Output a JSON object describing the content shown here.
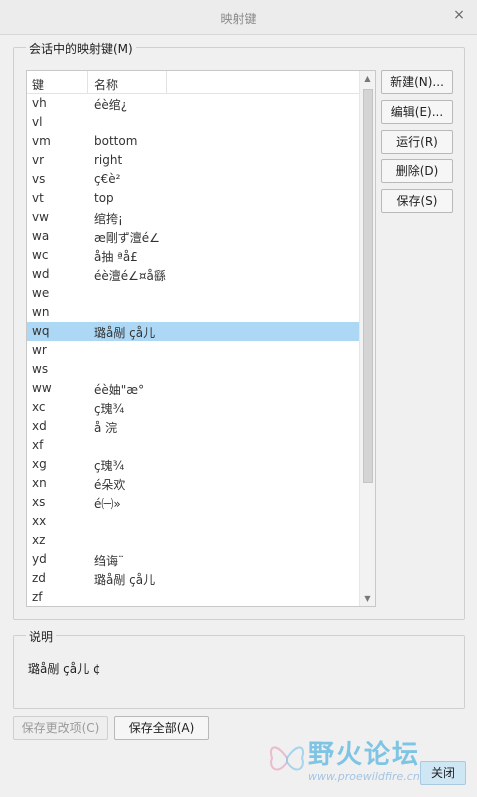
{
  "window": {
    "title": "映射键",
    "close_symbol": "×"
  },
  "mappings_group": {
    "label": "会话中的映射键(M)"
  },
  "list": {
    "columns": {
      "key": "键",
      "name": "名称"
    },
    "rows": [
      {
        "key": "vh",
        "name": "éè绾¿",
        "selected": false
      },
      {
        "key": "vl",
        "name": "",
        "selected": false
      },
      {
        "key": "vm",
        "name": "bottom",
        "selected": false
      },
      {
        "key": "vr",
        "name": "right",
        "selected": false
      },
      {
        "key": "vs",
        "name": "ç€è²",
        "selected": false
      },
      {
        "key": "vt",
        "name": "top",
        "selected": false
      },
      {
        "key": "vw",
        "name": "绾挎¡",
        "selected": false
      },
      {
        "key": "wa",
        "name": "æ剛ず澶é∠",
        "selected": false
      },
      {
        "key": "wc",
        "name": "å抽   ªå£",
        "selected": false
      },
      {
        "key": "wd",
        "name": "éè澶é∠¤å繇",
        "selected": false
      },
      {
        "key": "we",
        "name": "",
        "selected": false
      },
      {
        "key": "wn",
        "name": "",
        "selected": false
      },
      {
        "key": "wq",
        "name": "璐å剮   çå儿",
        "selected": true
      },
      {
        "key": "wr",
        "name": "",
        "selected": false
      },
      {
        "key": "ws",
        "name": "",
        "selected": false
      },
      {
        "key": "ww",
        "name": "éè妯\"æ°",
        "selected": false
      },
      {
        "key": "xc",
        "name": "ç瑰¾",
        "selected": false
      },
      {
        "key": "xd",
        "name": "å 浣",
        "selected": false
      },
      {
        "key": "xf",
        "name": "",
        "selected": false
      },
      {
        "key": "xg",
        "name": "ç瑰¾",
        "selected": false
      },
      {
        "key": "xn",
        "name": "é朵欢",
        "selected": false
      },
      {
        "key": "xs",
        "name": "é㈠»",
        "selected": false
      },
      {
        "key": "xx",
        "name": "",
        "selected": false
      },
      {
        "key": "xz",
        "name": "",
        "selected": false
      },
      {
        "key": "yd",
        "name": "绉诲¨",
        "selected": false
      },
      {
        "key": "zd",
        "name": "璐å剮   çå儿",
        "selected": false
      },
      {
        "key": "zf",
        "name": "",
        "selected": false
      }
    ]
  },
  "buttons": {
    "new": "新建(N)...",
    "edit": "编辑(E)...",
    "run": "运行(R)",
    "delete": "删除(D)",
    "save": "保存(S)"
  },
  "description_group": {
    "label": "说明",
    "text": "璐å剮   çå儿   ¢"
  },
  "footer": {
    "save_changes": "保存更改项(C)",
    "save_all": "保存全部(A)",
    "close": "关闭"
  },
  "watermark": {
    "brand": "野火论坛",
    "url": "www.proewildfire.cn"
  },
  "colors": {
    "selection": "#add8f5",
    "watermark": "#59b6e0"
  }
}
